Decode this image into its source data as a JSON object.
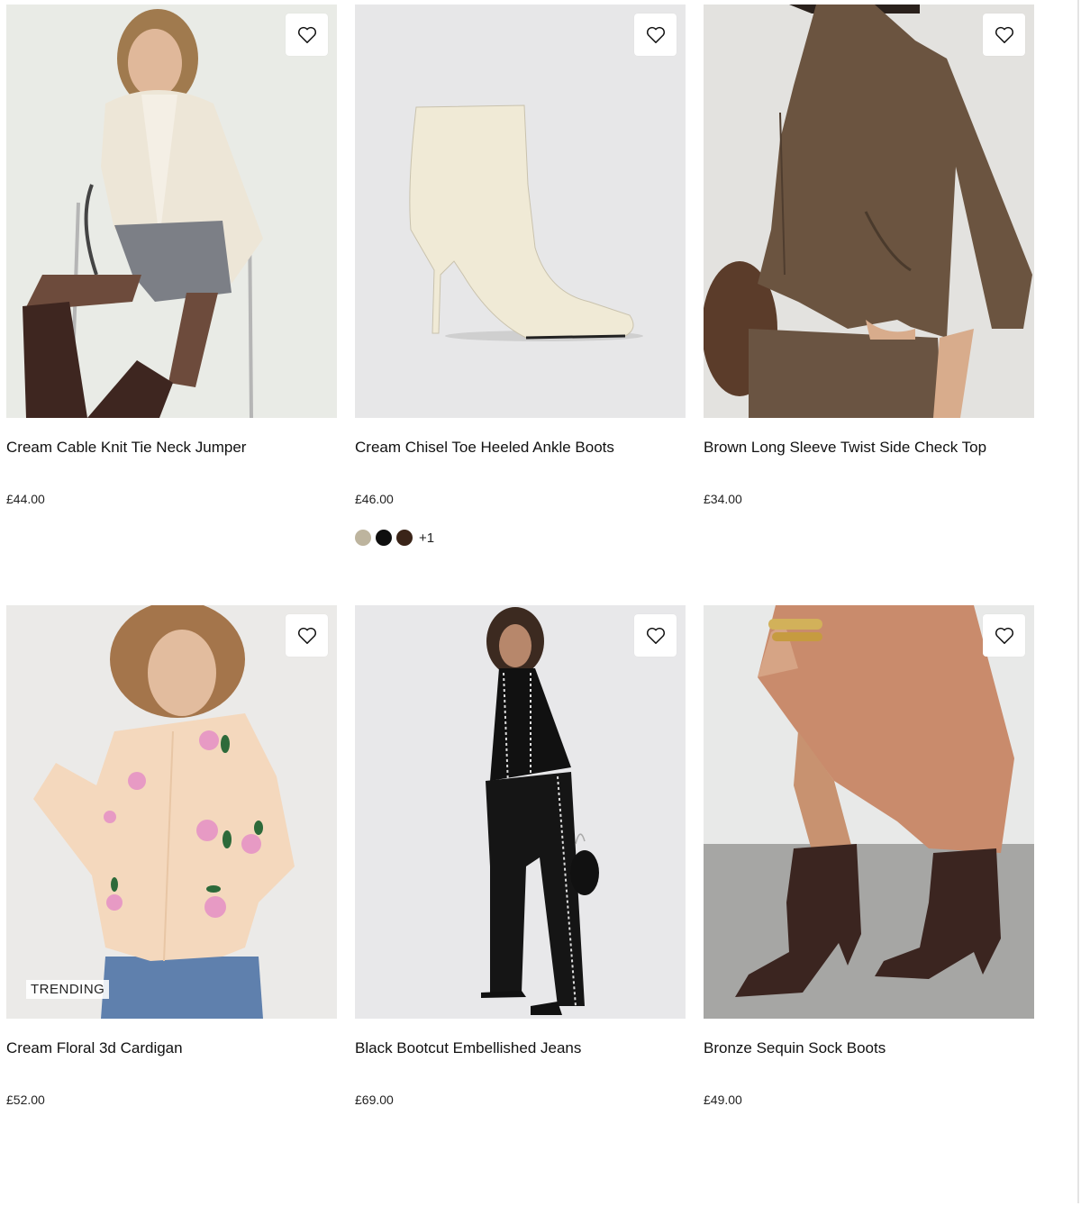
{
  "products": [
    {
      "title": "Cream Cable Knit Tie Neck Jumper",
      "price": "£44.00",
      "badge": "",
      "wishlist_icon": "heart-icon",
      "image": {
        "bg": "#e9ebe6",
        "desc": "model in cream cable knit jumper and brown knee boots"
      }
    },
    {
      "title": "Cream Chisel Toe Heeled Ankle Boots",
      "price": "£46.00",
      "badge": "",
      "wishlist_icon": "heart-icon",
      "image": {
        "bg": "#e7e7e8",
        "desc": "cream croc heeled ankle boot"
      },
      "swatches": [
        "#bdb49e",
        "#0f0f0f",
        "#3a2418"
      ],
      "more_colors": "+1"
    },
    {
      "title": "Brown Long Sleeve Twist Side Check Top",
      "price": "£34.00",
      "badge": "",
      "wishlist_icon": "heart-icon",
      "image": {
        "bg": "#e3e2df",
        "desc": "model in brown check twist top"
      }
    },
    {
      "title": "Cream Floral 3d Cardigan",
      "price": "£52.00",
      "badge": "TRENDING",
      "wishlist_icon": "heart-icon",
      "image": {
        "bg": "#ebeae8",
        "desc": "model in cream floral cardigan"
      }
    },
    {
      "title": "Black Bootcut Embellished Jeans",
      "price": "£69.00",
      "badge": "",
      "wishlist_icon": "heart-icon",
      "image": {
        "bg": "#e8e8ea",
        "desc": "model in black embellished bootcut jeans"
      }
    },
    {
      "title": "Bronze Sequin Sock Boots",
      "price": "£49.00",
      "badge": "",
      "wishlist_icon": "heart-icon",
      "image": {
        "bg": "#dcdcdc",
        "desc": "bronze sequin sock boots with satin skirt"
      }
    }
  ]
}
